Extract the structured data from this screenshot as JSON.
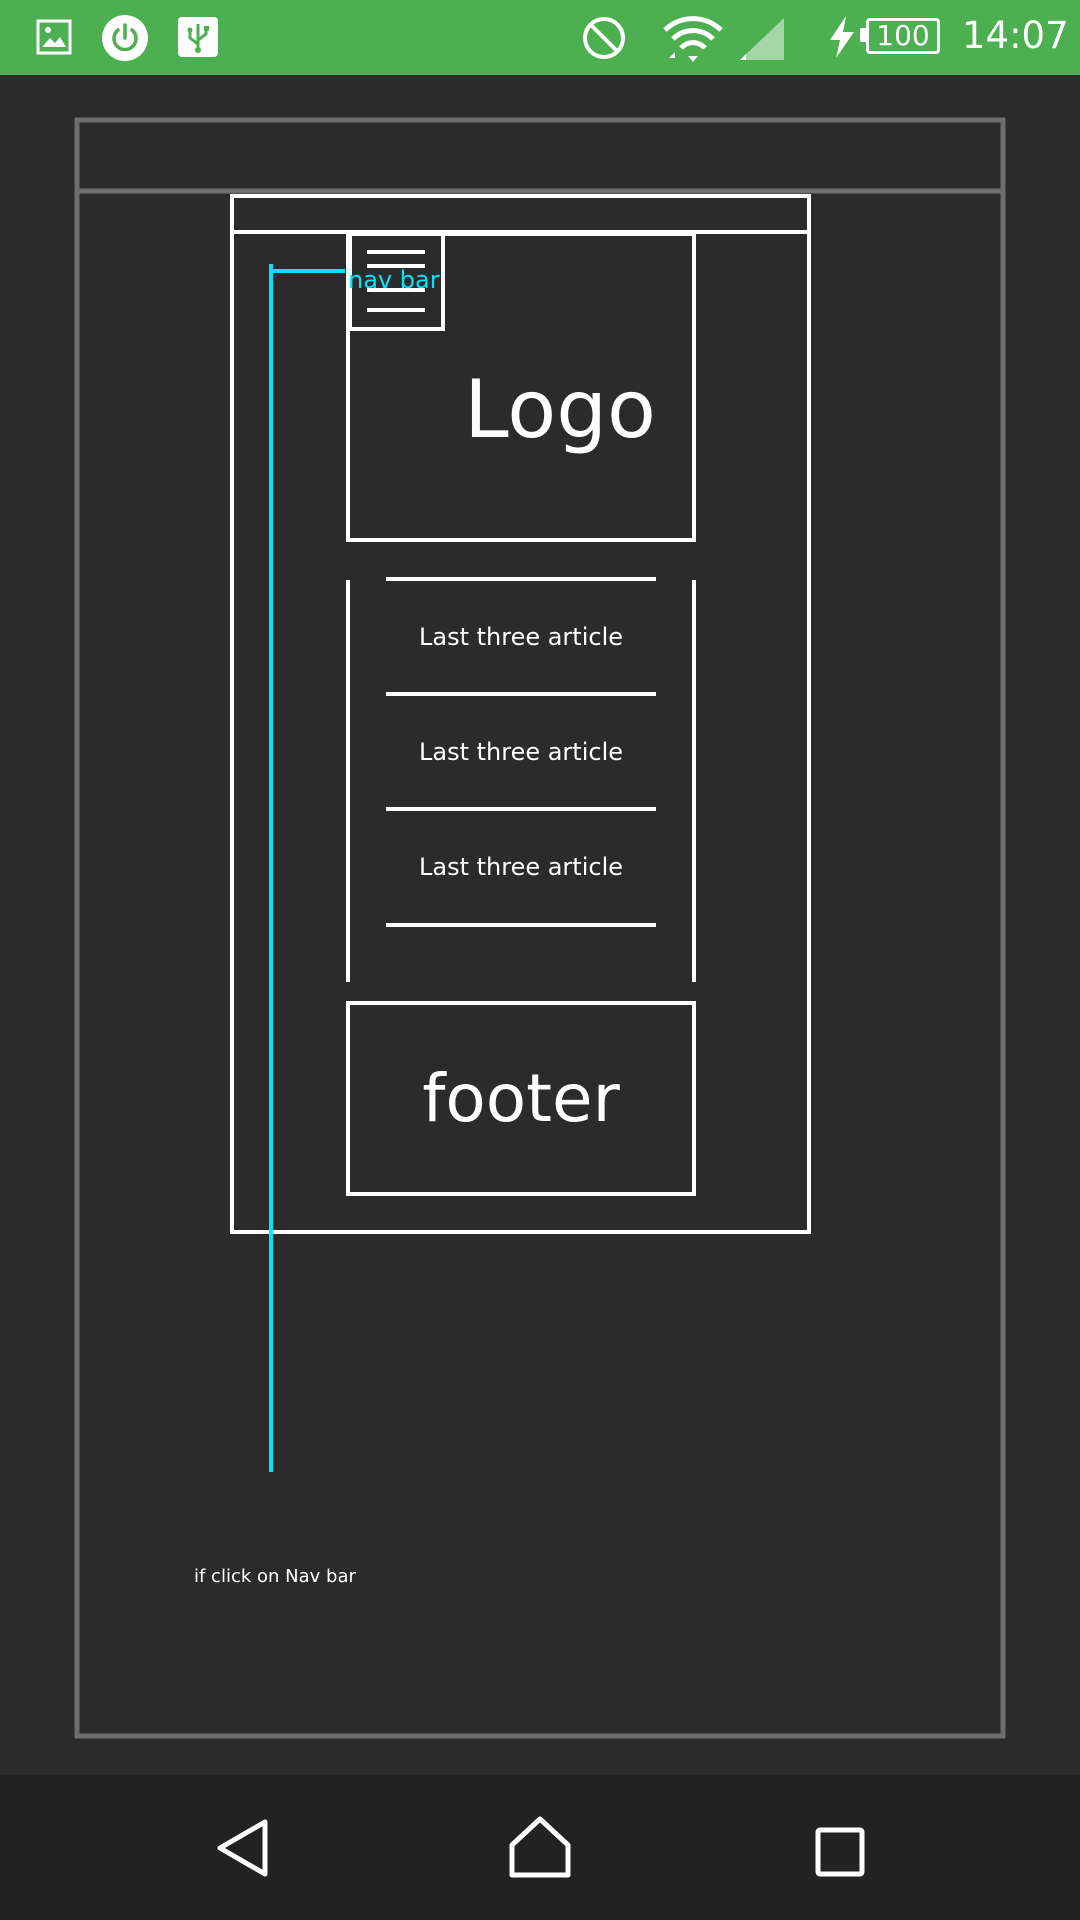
{
  "status_bar": {
    "time": "14:07",
    "battery_level": "100",
    "icons": [
      "image-icon",
      "power-icon",
      "usb-icon",
      "do-not-disturb-icon",
      "wifi-icon",
      "cell-signal-icon",
      "charging-icon",
      "battery-icon"
    ],
    "background_color": "#4caf50"
  },
  "wireframe": {
    "logo_label": "Logo",
    "articles": [
      {
        "label": "Last three article"
      },
      {
        "label": "Last three article"
      },
      {
        "label": "Last three article"
      }
    ],
    "footer_label": "footer",
    "nav_annotation": "nav bar",
    "click_note": "if click on Nav bar",
    "annotation_color": "#00e5ff",
    "line_color": "#ffffff",
    "frame_color": "#6e6e6e"
  },
  "navigation": {
    "buttons": [
      "back-button",
      "home-button",
      "recents-button"
    ]
  }
}
